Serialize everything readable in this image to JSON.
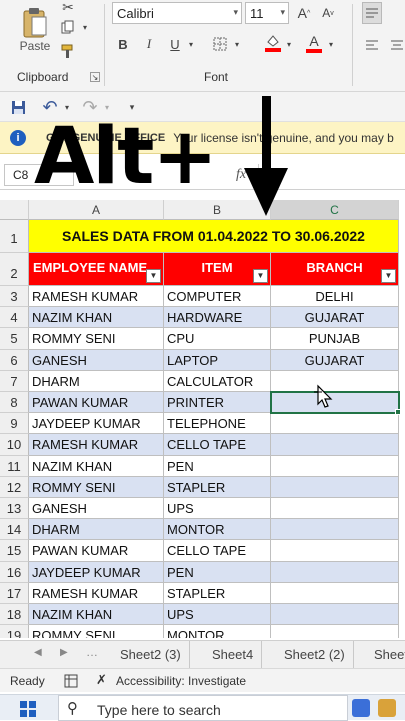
{
  "ribbon": {
    "paste_label": "Paste",
    "clipboard_label": "Clipboard",
    "font_label": "Font",
    "font_name": "Calibri",
    "font_size": "11",
    "bold": "B",
    "italic": "I",
    "underline": "U"
  },
  "infobar": {
    "title": "GET GENUINE OFFICE",
    "message": "Your license isn't genuine, and you may b"
  },
  "formula_bar": {
    "name_box": "C8",
    "fx": "fx"
  },
  "overlay": {
    "text": "Alt+"
  },
  "grid": {
    "columns": [
      "A",
      "B",
      "C"
    ],
    "title": "SALES DATA FROM 01.04.2022 TO 30.06.2022",
    "headers": [
      "EMPLOYEE NAME",
      "ITEM",
      "BRANCH"
    ],
    "rows": [
      {
        "num": "3",
        "name": "RAMESH KUMAR",
        "item": "COMPUTER",
        "branch": "DELHI"
      },
      {
        "num": "4",
        "name": "NAZIM KHAN",
        "item": "HARDWARE",
        "branch": "GUJARAT"
      },
      {
        "num": "5",
        "name": "ROMMY SENI",
        "item": "CPU",
        "branch": "PUNJAB"
      },
      {
        "num": "6",
        "name": "GANESH",
        "item": "LAPTOP",
        "branch": "GUJARAT"
      },
      {
        "num": "7",
        "name": "DHARM",
        "item": "CALCULATOR",
        "branch": ""
      },
      {
        "num": "8",
        "name": "PAWAN KUMAR",
        "item": "PRINTER",
        "branch": ""
      },
      {
        "num": "9",
        "name": "JAYDEEP KUMAR",
        "item": "TELEPHONE",
        "branch": ""
      },
      {
        "num": "10",
        "name": "RAMESH KUMAR",
        "item": "CELLO TAPE",
        "branch": ""
      },
      {
        "num": "11",
        "name": "NAZIM KHAN",
        "item": "PEN",
        "branch": ""
      },
      {
        "num": "12",
        "name": "ROMMY SENI",
        "item": "STAPLER",
        "branch": ""
      },
      {
        "num": "13",
        "name": "GANESH",
        "item": "UPS",
        "branch": ""
      },
      {
        "num": "14",
        "name": "DHARM",
        "item": "MONTOR",
        "branch": ""
      },
      {
        "num": "15",
        "name": "PAWAN KUMAR",
        "item": "CELLO TAPE",
        "branch": ""
      },
      {
        "num": "16",
        "name": "JAYDEEP KUMAR",
        "item": "PEN",
        "branch": ""
      },
      {
        "num": "17",
        "name": "RAMESH KUMAR",
        "item": "STAPLER",
        "branch": ""
      },
      {
        "num": "18",
        "name": "NAZIM KHAN",
        "item": "UPS",
        "branch": ""
      },
      {
        "num": "19",
        "name": "ROMMY SENI",
        "item": "MONTOR",
        "branch": ""
      }
    ],
    "selected_cell": "C8"
  },
  "sheet_tabs": [
    "Sheet2 (3)",
    "Sheet4",
    "Sheet2 (2)",
    "Sheet"
  ],
  "status": {
    "ready": "Ready",
    "accessibility": "Accessibility: Investigate"
  },
  "taskbar": {
    "search_placeholder": "Type here to search"
  },
  "colors": {
    "title_fill": "#ffff00",
    "header_fill": "#ff0000",
    "band_fill": "#d9e1f2",
    "selection": "#217346"
  }
}
